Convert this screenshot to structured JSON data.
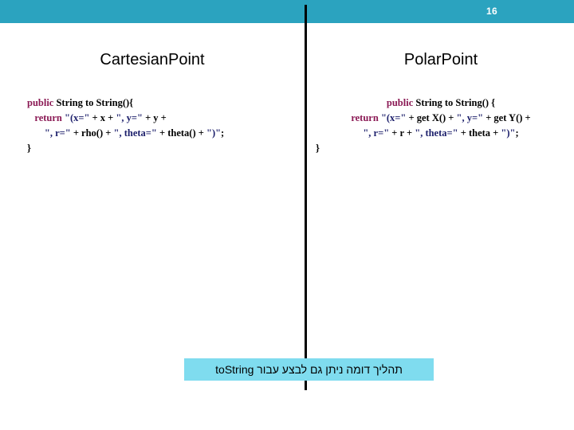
{
  "slide": {
    "page_number": "16",
    "header_color": "#2ba3bf",
    "caption_background": "#7fdcef",
    "divider_color": "#000000"
  },
  "columns": {
    "left_title": "CartesianPoint",
    "right_title": "PolarPoint"
  },
  "code": {
    "left": {
      "l1_kw": "public",
      "l1_rest": " String to String(){",
      "l2_kw": "return",
      "l2_str1": "\"(x=\"",
      "l2_mid1": " + x + ",
      "l2_str2": "\", y=\"",
      "l2_mid2": " + y +",
      "l3_str1": "\", r=\"",
      "l3_mid1": " + rho() + ",
      "l3_str2": "\", theta=\"",
      "l3_mid2": " + theta() + ",
      "l3_str3": "\")\"",
      "l3_end": ";",
      "l4": "}"
    },
    "right": {
      "l1_kw": "public",
      "l1_rest": " String to String() {",
      "l2_kw": "return",
      "l2_str1": "\"(x=\"",
      "l2_mid1": " + get X() + ",
      "l2_str2": "\", y=\"",
      "l2_mid2": " + get Y() +",
      "l3_str1": "\", r=\"",
      "l3_mid1": " + r + ",
      "l3_str2": "\", theta=\"",
      "l3_mid2": " + theta + ",
      "l3_str3": "\")\"",
      "l3_end": ";",
      "l4": "}"
    }
  },
  "caption": {
    "text": "תהליך דומה ניתן גם לבצע עבור toString"
  }
}
